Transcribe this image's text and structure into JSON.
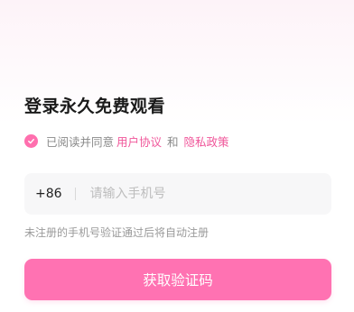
{
  "login": {
    "title": "登录永久免费观看",
    "agreement": {
      "checked": true,
      "prefix": "已阅读并同意",
      "user_agreement": "用户协议",
      "and": "和",
      "privacy_policy": "隐私政策"
    },
    "phone": {
      "country_code": "+86",
      "value": "",
      "placeholder": "请输入手机号"
    },
    "hint": "未注册的手机号验证通过后将自动注册",
    "submit_label": "获取验证码"
  },
  "colors": {
    "accent": "#ff72b2",
    "link": "#f0569a",
    "input_bg": "#f7f7f8"
  }
}
